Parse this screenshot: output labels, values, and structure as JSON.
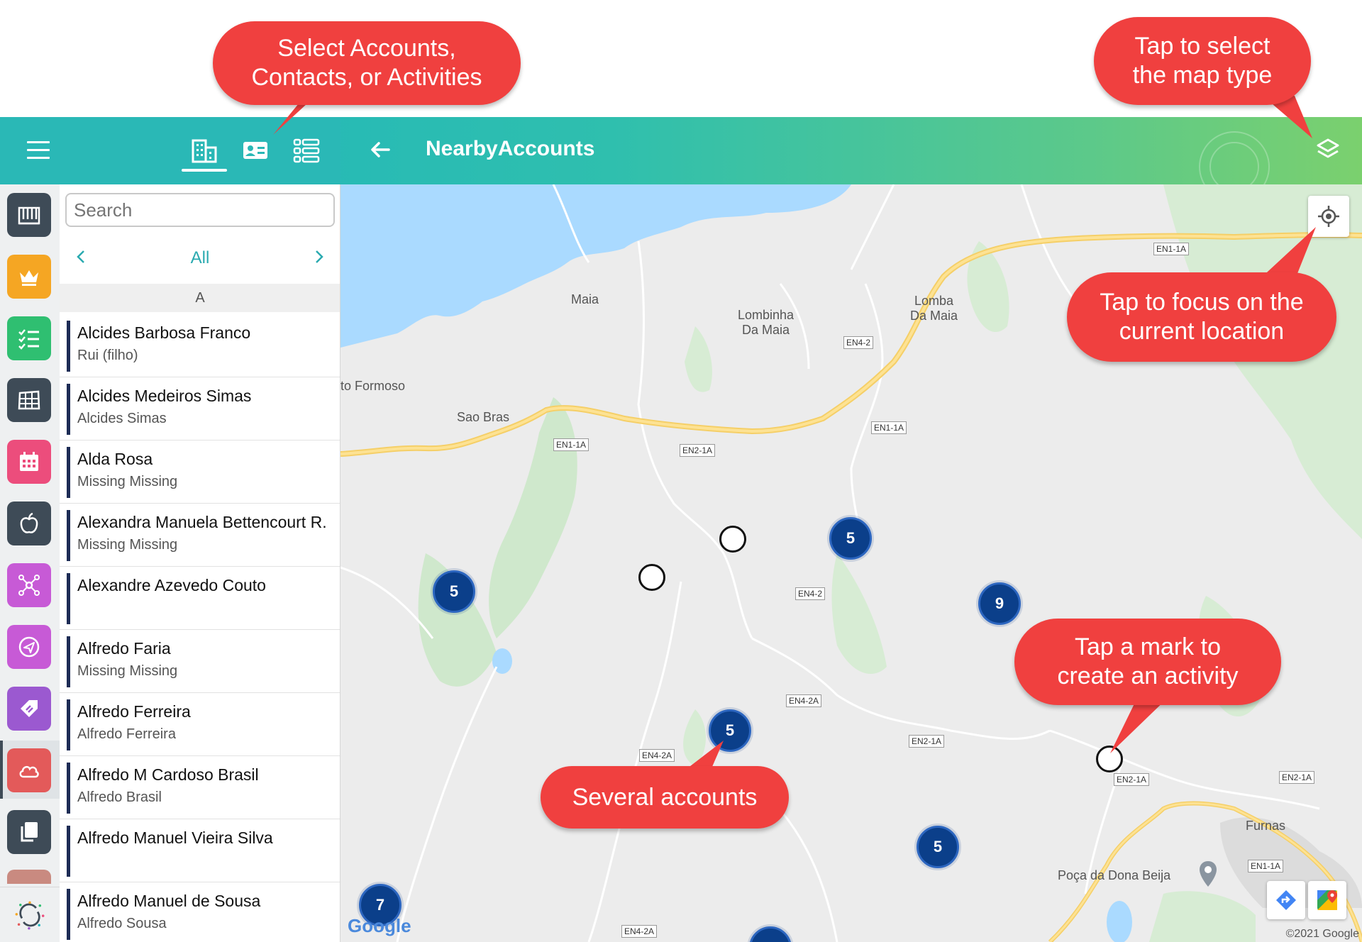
{
  "header": {
    "title": "NearbyAccounts",
    "segments": [
      "accounts-icon",
      "contacts-icon",
      "activities-icon"
    ]
  },
  "rail": {
    "items": [
      {
        "icon": "piano-icon",
        "color": "#3e4b57"
      },
      {
        "icon": "crown-icon",
        "color": "#f5a623"
      },
      {
        "icon": "checklist-icon",
        "color": "#2fbf71"
      },
      {
        "icon": "grid-icon",
        "color": "#3e4b57"
      },
      {
        "icon": "calendar-icon",
        "color": "#ec4d7c"
      },
      {
        "icon": "apple-icon",
        "color": "#3e4b57"
      },
      {
        "icon": "network-icon",
        "color": "#c75ad6"
      },
      {
        "icon": "send-icon",
        "color": "#c75ad6"
      },
      {
        "icon": "tag-icon",
        "color": "#9b59d0"
      },
      {
        "icon": "cloud-icon",
        "color": "#e35a5a"
      },
      {
        "icon": "documents-icon",
        "color": "#3e4b57"
      }
    ],
    "sync_icon": "sync-icon"
  },
  "list": {
    "search_placeholder": "Search",
    "filter_label": "All",
    "section": "A",
    "rows": [
      {
        "name": "Alcides Barbosa Franco",
        "sub": "Rui (filho)"
      },
      {
        "name": "Alcides Medeiros Simas",
        "sub": "Alcides Simas"
      },
      {
        "name": "Alda Rosa",
        "sub": "Missing Missing"
      },
      {
        "name": "Alexandra Manuela Bettencourt R.",
        "sub": "Missing Missing"
      },
      {
        "name": "Alexandre Azevedo Couto",
        "sub": ""
      },
      {
        "name": "Alfredo Faria",
        "sub": "Missing Missing"
      },
      {
        "name": "Alfredo Ferreira",
        "sub": "Alfredo Ferreira"
      },
      {
        "name": "Alfredo M Cardoso Brasil",
        "sub": "Alfredo Brasil"
      },
      {
        "name": "Alfredo Manuel Vieira Silva",
        "sub": ""
      },
      {
        "name": "Alfredo Manuel de Sousa",
        "sub": "Alfredo Sousa"
      }
    ]
  },
  "map": {
    "places": {
      "maia": "Maia",
      "lombinha": "Lombinha\nDa Maia",
      "lomba": "Lomba\nDa Maia",
      "formoso": "to Formoso",
      "saobras": "Sao Bras",
      "furnas": "Furnas",
      "poca": "Poça da Dona Beija"
    },
    "roads": {
      "en1a_1": "EN1-1A",
      "en1a_2": "EN1-1A",
      "en1a_3": "EN1-1A",
      "en1a_4": "EN1-1A",
      "en2a_1": "EN2-1A",
      "en2a_2": "EN2-1A",
      "en2a_3": "EN2-1A",
      "en2a_4": "EN2-1A",
      "en42_1": "EN4-2",
      "en42_2": "EN4-2",
      "en42a_1": "EN4-2A",
      "en42a_2": "EN4-2A",
      "en42a_3": "EN4-2A"
    },
    "clusters": {
      "c1": "5",
      "c2": "5",
      "c3": "9",
      "c4": "5",
      "c5": "5",
      "c6": "7"
    },
    "google": "Google",
    "copyright": "©2021 Google"
  },
  "callouts": {
    "select": "Select Accounts,\nContacts, or Activities",
    "maptype": "Tap to select\nthe map type",
    "focus": "Tap to focus on the\ncurrent location",
    "mark": "Tap a mark to\ncreate an activity",
    "several": "Several accounts"
  },
  "colors": {
    "accent": "#2ab8b6",
    "callout": "#f0403f",
    "cluster": "#0b3f8a"
  }
}
